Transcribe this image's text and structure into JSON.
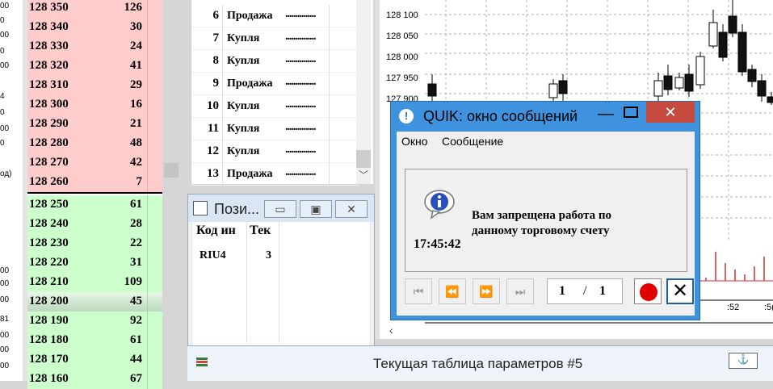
{
  "left_clip": {
    "values": [
      "00",
      "0",
      "00",
      "0",
      "00",
      "4",
      "0",
      "00",
      "0",
      "од)",
      "",
      "",
      "00",
      "00",
      "00",
      "81",
      "00",
      "00",
      "00"
    ]
  },
  "order_book": {
    "asks": [
      {
        "price": "128 350",
        "vol": "126"
      },
      {
        "price": "128 340",
        "vol": "30"
      },
      {
        "price": "128 330",
        "vol": "24"
      },
      {
        "price": "128 320",
        "vol": "41"
      },
      {
        "price": "128 310",
        "vol": "29"
      },
      {
        "price": "128 300",
        "vol": "16"
      },
      {
        "price": "128 290",
        "vol": "21"
      },
      {
        "price": "128 280",
        "vol": "48"
      },
      {
        "price": "128 270",
        "vol": "42"
      },
      {
        "price": "128 260",
        "vol": "7"
      }
    ],
    "bids": [
      {
        "price": "128 250",
        "vol": "61"
      },
      {
        "price": "128 240",
        "vol": "28"
      },
      {
        "price": "128 230",
        "vol": "22"
      },
      {
        "price": "128 220",
        "vol": "31"
      },
      {
        "price": "128 210",
        "vol": "109"
      },
      {
        "price": "128 200",
        "vol": "45"
      },
      {
        "price": "128 190",
        "vol": "92"
      },
      {
        "price": "128 180",
        "vol": "61"
      },
      {
        "price": "128 170",
        "vol": "44"
      },
      {
        "price": "128 160",
        "vol": "67"
      }
    ]
  },
  "trades": {
    "rows": [
      {
        "num": "6",
        "side": "Продажа",
        "dots": "..............."
      },
      {
        "num": "7",
        "side": "Купля",
        "dots": "..............."
      },
      {
        "num": "8",
        "side": "Купля",
        "dots": "..............."
      },
      {
        "num": "9",
        "side": "Продажа",
        "dots": "..............."
      },
      {
        "num": "10",
        "side": "Купля",
        "dots": "..............."
      },
      {
        "num": "11",
        "side": "Купля",
        "dots": "..............."
      },
      {
        "num": "12",
        "side": "Купля",
        "dots": "..............."
      },
      {
        "num": "13",
        "side": "Продажа",
        "dots": "..............."
      }
    ]
  },
  "positions": {
    "title": "Пози...",
    "col1": "Код ин",
    "col2": "Тек",
    "code": "RIU4",
    "qty": "3"
  },
  "chart": {
    "y_labels": [
      "128 100",
      "128 050",
      "128 000",
      "127 950",
      "127 900"
    ],
    "x_labels": [
      ":52",
      ":5("
    ]
  },
  "params": {
    "title": "Текущая таблица параметров #5",
    "btn": "⚓"
  },
  "dialog": {
    "title": "QUIK: окно сообщений",
    "menu": [
      "Окно",
      "Сообщение"
    ],
    "time": "17:45:42",
    "message": "Вам запрещена работа по данному торговому счету",
    "page_current": "1",
    "page_sep": "/",
    "page_total": "1"
  }
}
